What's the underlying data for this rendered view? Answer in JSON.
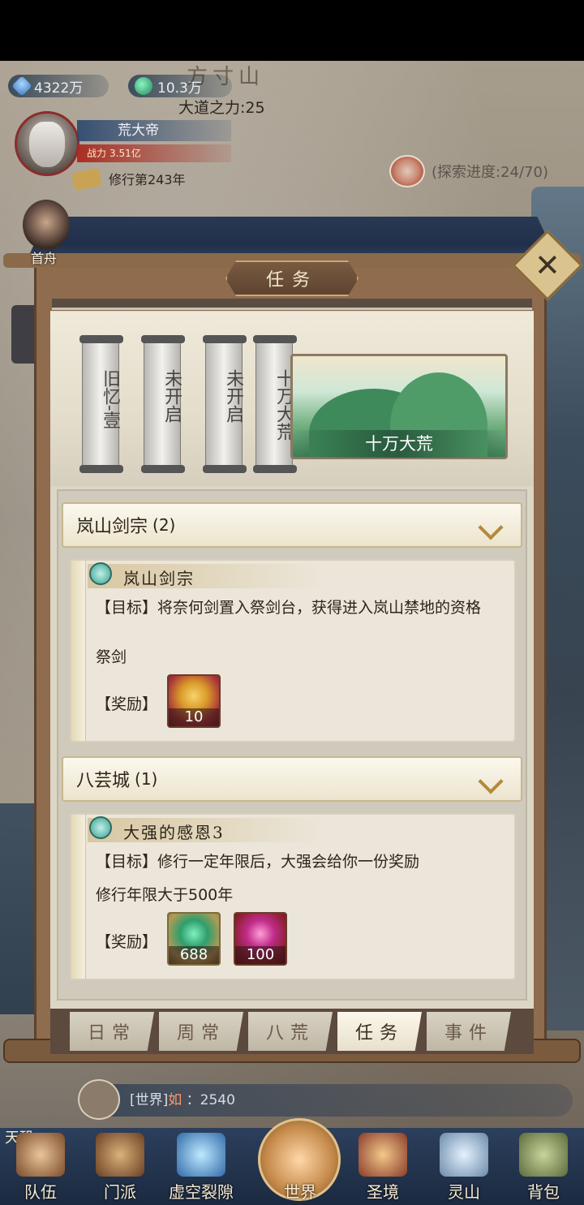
{
  "header": {
    "spirit_stones": "4322万",
    "jade": "10.3万",
    "location_title": "方寸山",
    "dao_power": "大道之力:25",
    "explore_progress": "(探索进度:24/70)"
  },
  "player": {
    "name": "荒大帝",
    "power_label": "战力",
    "power_value": "3.51亿",
    "cultivation_years": "修行第243年",
    "companion_label": "首舟"
  },
  "panel": {
    "title": "任务",
    "close_glyph": "✕"
  },
  "chapters": [
    {
      "label": "旧忆-壹"
    },
    {
      "label": "未开启"
    },
    {
      "label": "未开启"
    },
    {
      "label": "十万大荒"
    }
  ],
  "active_chapter": "十万大荒",
  "groups": [
    {
      "name": "岚山剑宗",
      "count": "(2)",
      "quest": {
        "title": "岚山剑宗",
        "goal": "【目标】将奈何剑置入祭剑台，获得进入岚山禁地的资格",
        "sub": "祭剑",
        "reward_label": "【奖励】",
        "rewards": [
          {
            "type": "gold-chest",
            "count": "10"
          }
        ]
      }
    },
    {
      "name": "八芸城",
      "count": "(1)",
      "quest": {
        "title": "大强的感恩3",
        "goal": "【目标】修行一定年限后，大强会给你一份奖励",
        "sub": "修行年限大于500年",
        "reward_label": "【奖励】",
        "rewards": [
          {
            "type": "jade",
            "count": "688"
          },
          {
            "type": "orb",
            "count": "100"
          }
        ]
      }
    }
  ],
  "tabs": [
    {
      "label": "日常",
      "active": false
    },
    {
      "label": "周常",
      "active": false
    },
    {
      "label": "八荒",
      "active": false
    },
    {
      "label": "任务",
      "active": true
    },
    {
      "label": "事件",
      "active": false
    }
  ],
  "chat": {
    "channel": "[世界]",
    "speaker": "如",
    "message": "：2540"
  },
  "nav": [
    {
      "label": "队伍"
    },
    {
      "label": "门派"
    },
    {
      "label": "虚空裂隙"
    },
    {
      "label": "世界"
    },
    {
      "label": "圣境"
    },
    {
      "label": "灵山"
    },
    {
      "label": "背包"
    }
  ],
  "corner_label": "天玑"
}
